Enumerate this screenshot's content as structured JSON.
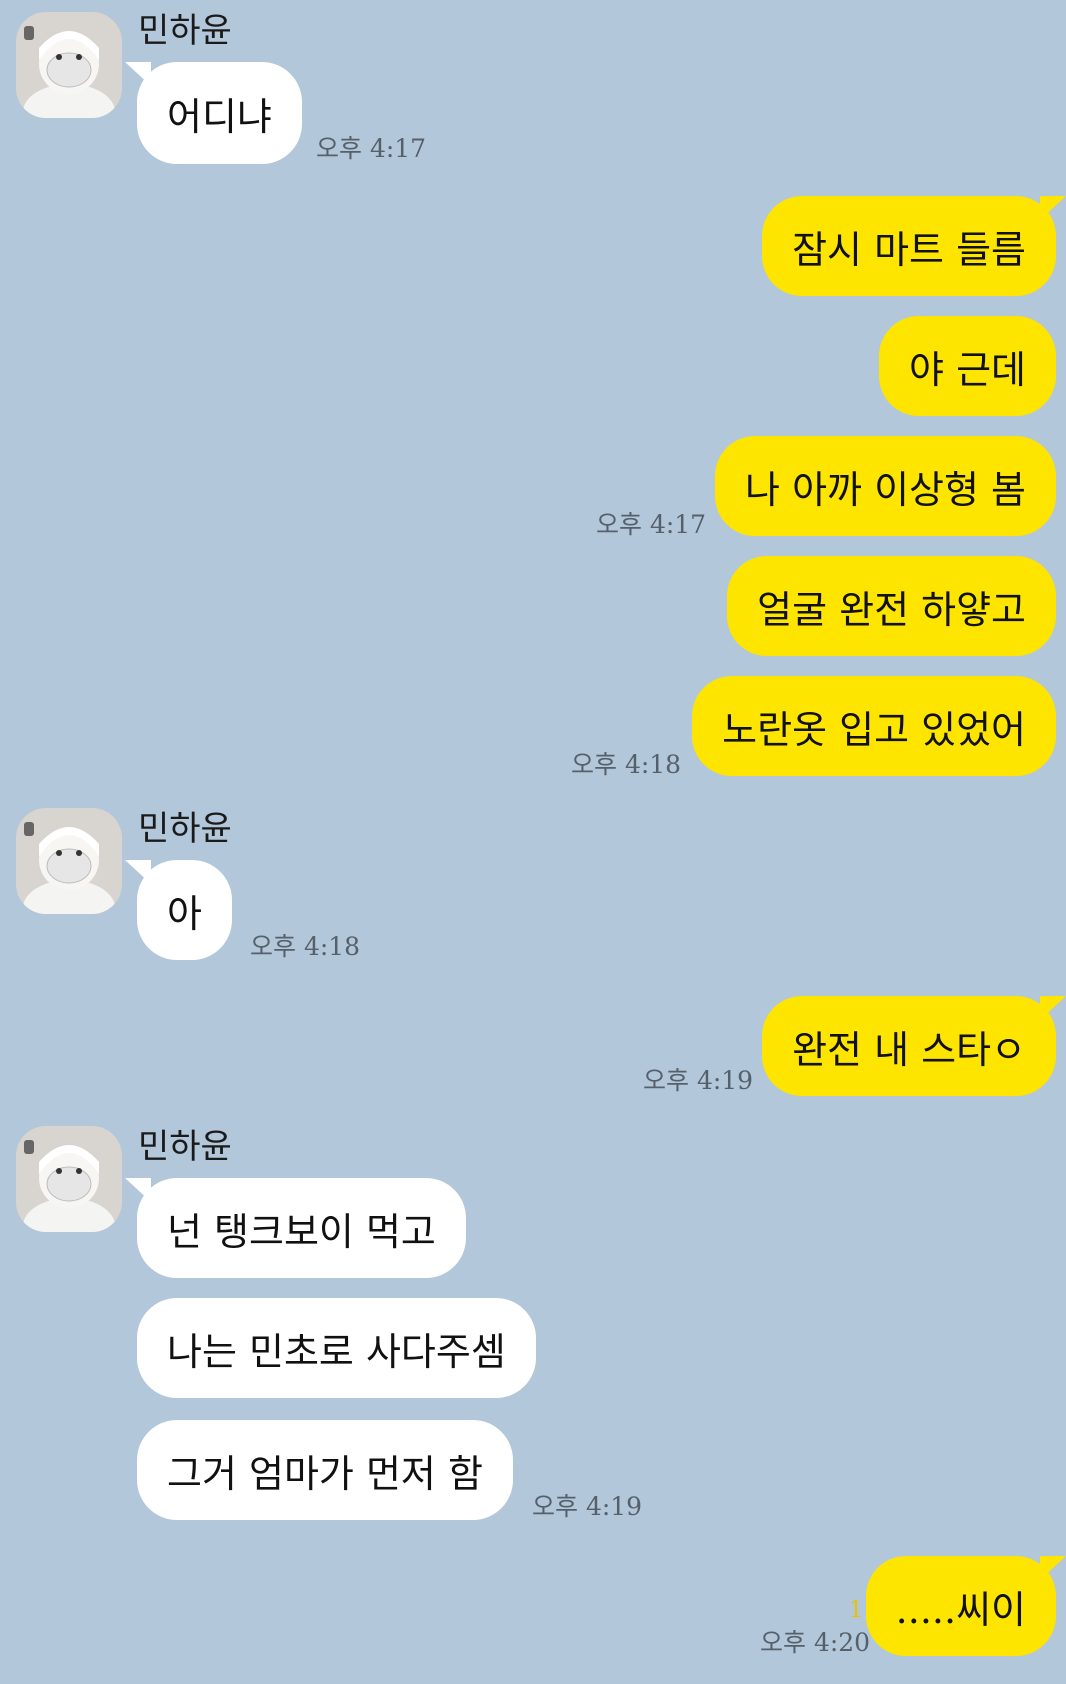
{
  "sender_name": "민하윤",
  "messages": {
    "m1": "어디냐",
    "m2": "잠시 마트 들름",
    "m3": "야 근데",
    "m4": "나 아까 이상형 봄",
    "m5": "얼굴 완전 하얗고",
    "m6": "노란옷 입고 있었어",
    "m7": "아",
    "m8": "완전 내 스타ㅇ",
    "m9": "넌 탱크보이 먹고",
    "m10": "나는 민초로 사다주셈",
    "m11": "그거 엄마가 먼저 함",
    "m12": ".....씨이"
  },
  "times": {
    "t1": "오후 4:17",
    "t2": "오후 4:17",
    "t3": "오후 4:18",
    "t4": "오후 4:18",
    "t5": "오후 4:19",
    "t6": "오후 4:19",
    "t7": "오후 4:20"
  },
  "unread_count": "1",
  "colors": {
    "background": "#b2c7da",
    "incoming_bubble": "#ffffff",
    "outgoing_bubble": "#fee500",
    "unread": "#e8c200"
  }
}
